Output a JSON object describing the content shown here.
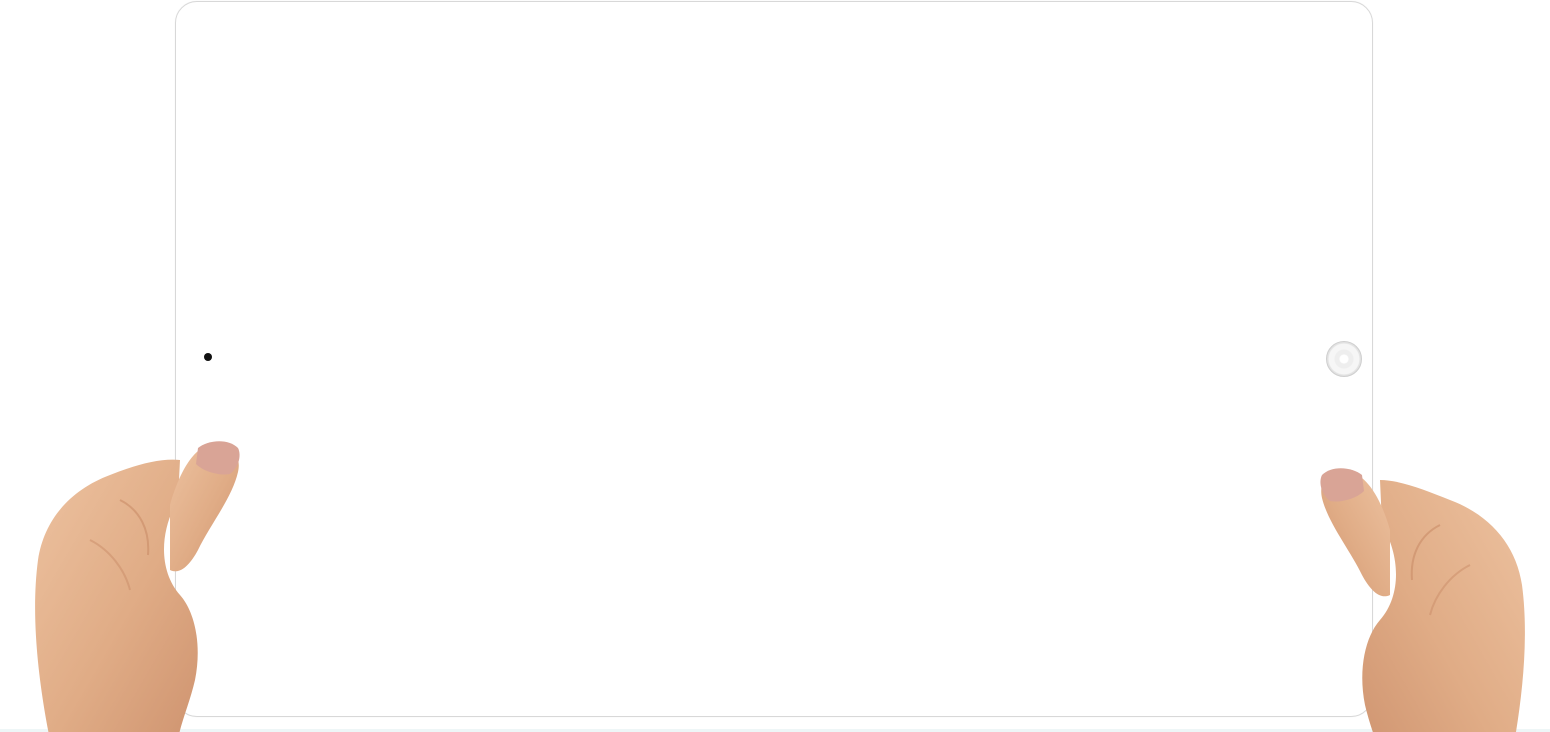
{
  "scene": {
    "subject": "tablet",
    "colors": {
      "background": "#ffffff",
      "tablet_body": "#ffffff",
      "tablet_edge": "#d8d8d8",
      "camera": "#111111",
      "skin": "#e2b28f",
      "skin_shadow": "#c98c67",
      "nail": "#d9a496"
    },
    "icons": {
      "camera": "camera-dot-icon",
      "home": "home-button-icon"
    }
  }
}
